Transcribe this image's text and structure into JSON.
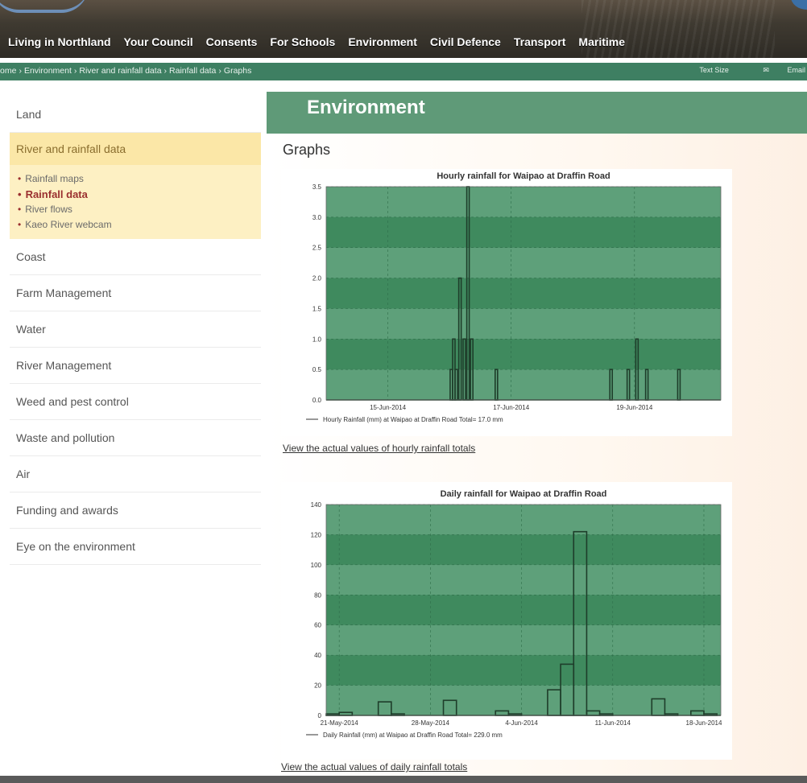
{
  "nav": {
    "items": [
      "Living in Northland",
      "Your Council",
      "Consents",
      "For Schools",
      "Environment",
      "Civil Defence",
      "Transport",
      "Maritime"
    ]
  },
  "breadcrumb": {
    "items": [
      "ome",
      "Environment",
      "River and rainfall data",
      "Rainfall data",
      "Graphs"
    ]
  },
  "tools": {
    "text_size": "Text Size",
    "email": "Email"
  },
  "sidebar": {
    "land": "Land",
    "active": {
      "label": "River and rainfall data",
      "subitems": [
        "Rainfall maps",
        "Rainfall data",
        "River flows",
        "Kaeo River webcam"
      ]
    },
    "items": [
      "Coast",
      "Farm Management",
      "Water",
      "River Management",
      "Weed and pest control",
      "Waste and pollution",
      "Air",
      "Funding and awards",
      "Eye on the environment"
    ]
  },
  "main": {
    "section_title": "Environment",
    "heading": "Graphs",
    "hourly_link": "View the actual values of hourly rainfall totals",
    "daily_link": "View the actual values of daily rainfall totals"
  },
  "colors": {
    "plot_bg": "#3f8a5e",
    "band_light": "#5ea07a",
    "series": "#1e3d2a"
  },
  "chart_data": [
    {
      "type": "bar",
      "title": "Hourly rainfall for Waipao at Draffin Road",
      "legend": "Hourly Rainfall (mm) at Waipao at Draffin Road Total= 17.0 mm",
      "ylim": [
        0,
        3.5
      ],
      "yticks": [
        "0.0",
        "0.5",
        "1.0",
        "1.5",
        "2.0",
        "2.5",
        "3.0",
        "3.5"
      ],
      "xticklabels": [
        "15-Jun-2014",
        "17-Jun-2014",
        "19-Jun-2014"
      ],
      "xtick_days": [
        1.0,
        3.0,
        5.0
      ],
      "xlim_days": [
        0,
        6.4
      ],
      "bars": [
        {
          "x": 2.03,
          "y": 0.5
        },
        {
          "x": 2.07,
          "y": 1.0
        },
        {
          "x": 2.11,
          "y": 0.5
        },
        {
          "x": 2.17,
          "y": 2.0
        },
        {
          "x": 2.24,
          "y": 1.0
        },
        {
          "x": 2.3,
          "y": 3.5
        },
        {
          "x": 2.36,
          "y": 1.0
        },
        {
          "x": 2.76,
          "y": 0.5
        },
        {
          "x": 4.62,
          "y": 0.5
        },
        {
          "x": 4.9,
          "y": 0.5
        },
        {
          "x": 5.04,
          "y": 1.0
        },
        {
          "x": 5.2,
          "y": 0.5
        },
        {
          "x": 5.72,
          "y": 0.5
        }
      ]
    },
    {
      "type": "bar",
      "title": "Daily rainfall for Waipao at Draffin Road",
      "legend": "Daily Rainfall (mm) at Waipao at Draffin Road Total= 229.0 mm",
      "ylim": [
        0,
        140
      ],
      "yticks": [
        "0",
        "20",
        "40",
        "60",
        "80",
        "100",
        "120",
        "140"
      ],
      "xticklabels": [
        "21-May-2014",
        "28-May-2014",
        "4-Jun-2014",
        "11-Jun-2014",
        "18-Jun-2014"
      ],
      "xtick_days": [
        1,
        8,
        15,
        22,
        29
      ],
      "xlim_days": [
        0,
        30.3
      ],
      "bars": [
        {
          "x": 0,
          "y": 1
        },
        {
          "x": 1,
          "y": 2
        },
        {
          "x": 2,
          "y": 0
        },
        {
          "x": 3,
          "y": 0
        },
        {
          "x": 4,
          "y": 9
        },
        {
          "x": 5,
          "y": 1
        },
        {
          "x": 6,
          "y": 0
        },
        {
          "x": 7,
          "y": 0
        },
        {
          "x": 8,
          "y": 0
        },
        {
          "x": 9,
          "y": 10
        },
        {
          "x": 10,
          "y": 0
        },
        {
          "x": 11,
          "y": 0
        },
        {
          "x": 12,
          "y": 0
        },
        {
          "x": 13,
          "y": 3
        },
        {
          "x": 14,
          "y": 1
        },
        {
          "x": 15,
          "y": 0
        },
        {
          "x": 16,
          "y": 0
        },
        {
          "x": 17,
          "y": 17
        },
        {
          "x": 18,
          "y": 34
        },
        {
          "x": 19,
          "y": 122
        },
        {
          "x": 20,
          "y": 3
        },
        {
          "x": 21,
          "y": 1
        },
        {
          "x": 22,
          "y": 0
        },
        {
          "x": 23,
          "y": 0
        },
        {
          "x": 24,
          "y": 0
        },
        {
          "x": 25,
          "y": 11
        },
        {
          "x": 26,
          "y": 1
        },
        {
          "x": 27,
          "y": 0
        },
        {
          "x": 28,
          "y": 3
        },
        {
          "x": 29,
          "y": 1
        }
      ]
    }
  ]
}
